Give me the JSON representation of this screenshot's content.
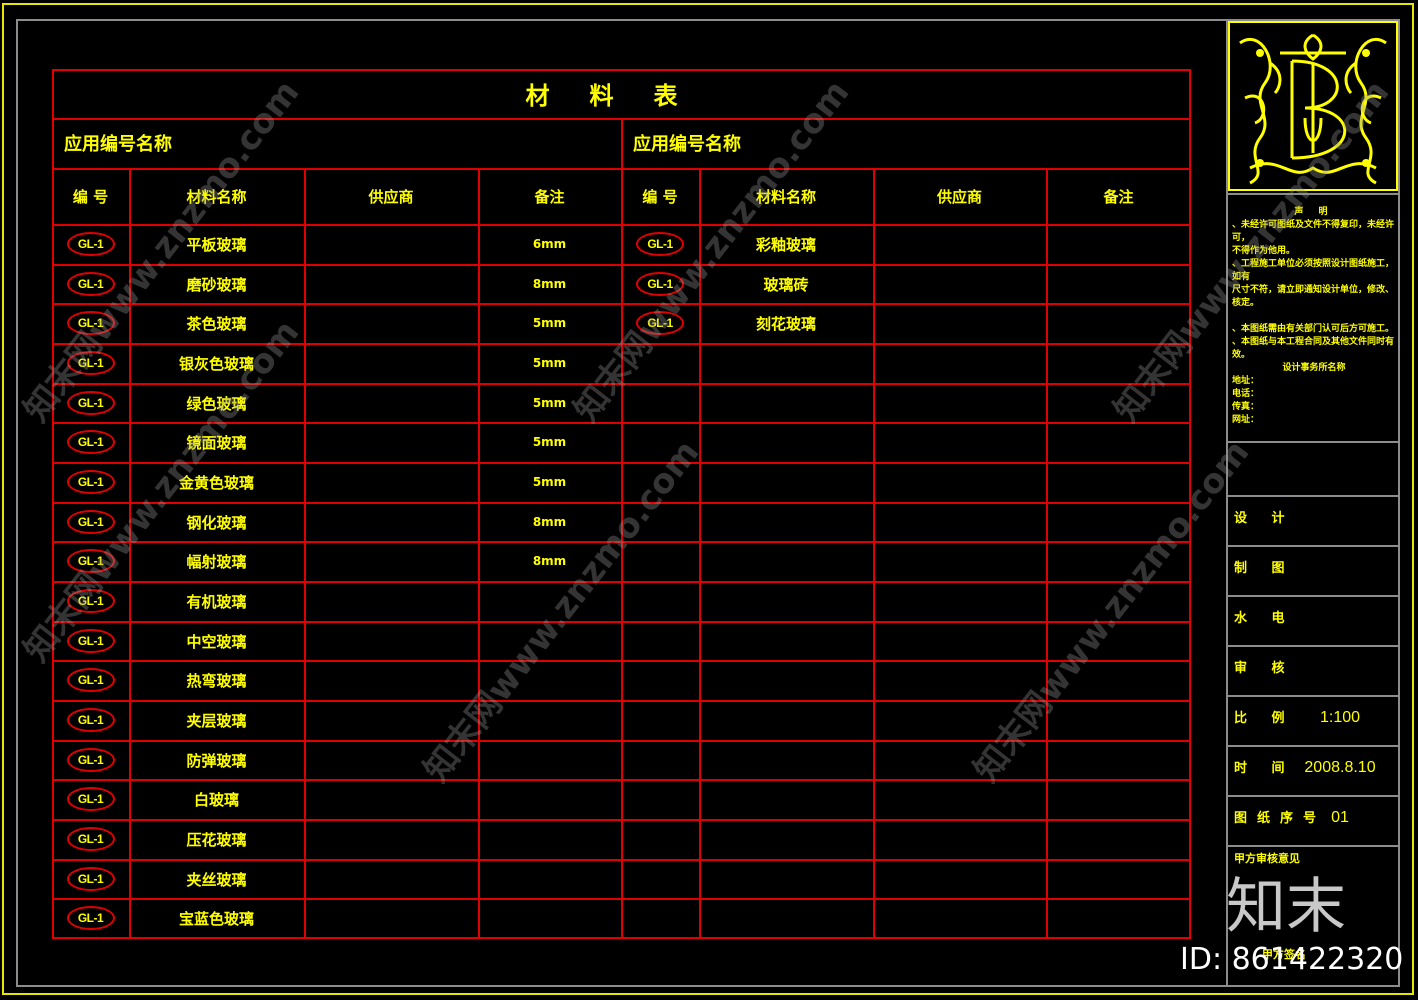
{
  "drawing": {
    "title": "材料表",
    "section_left": "应用编号名称",
    "section_right": "应用编号名称",
    "headers": [
      "编 号",
      "材料名称",
      "供应商",
      "备注"
    ],
    "left_rows": [
      {
        "code": "GL-1",
        "name": "平板玻璃",
        "supplier": "",
        "remark": "6mm"
      },
      {
        "code": "GL-1",
        "name": "磨砂玻璃",
        "supplier": "",
        "remark": "8mm"
      },
      {
        "code": "GL-1",
        "name": "茶色玻璃",
        "supplier": "",
        "remark": "5mm"
      },
      {
        "code": "GL-1",
        "name": "银灰色玻璃",
        "supplier": "",
        "remark": "5mm"
      },
      {
        "code": "GL-1",
        "name": "绿色玻璃",
        "supplier": "",
        "remark": "5mm"
      },
      {
        "code": "GL-1",
        "name": "镜面玻璃",
        "supplier": "",
        "remark": "5mm"
      },
      {
        "code": "GL-1",
        "name": "金黄色玻璃",
        "supplier": "",
        "remark": "5mm"
      },
      {
        "code": "GL-1",
        "name": "钢化玻璃",
        "supplier": "",
        "remark": "8mm"
      },
      {
        "code": "GL-1",
        "name": "幅射玻璃",
        "supplier": "",
        "remark": "8mm"
      },
      {
        "code": "GL-1",
        "name": "有机玻璃",
        "supplier": "",
        "remark": ""
      },
      {
        "code": "GL-1",
        "name": "中空玻璃",
        "supplier": "",
        "remark": ""
      },
      {
        "code": "GL-1",
        "name": "热弯玻璃",
        "supplier": "",
        "remark": ""
      },
      {
        "code": "GL-1",
        "name": "夹层玻璃",
        "supplier": "",
        "remark": ""
      },
      {
        "code": "GL-1",
        "name": "防弹玻璃",
        "supplier": "",
        "remark": ""
      },
      {
        "code": "GL-1",
        "name": "白玻璃",
        "supplier": "",
        "remark": ""
      },
      {
        "code": "GL-1",
        "name": "压花玻璃",
        "supplier": "",
        "remark": ""
      },
      {
        "code": "GL-1",
        "name": "夹丝玻璃",
        "supplier": "",
        "remark": ""
      },
      {
        "code": "GL-1",
        "name": "宝蓝色玻璃",
        "supplier": "",
        "remark": ""
      }
    ],
    "right_rows": [
      {
        "code": "GL-1",
        "name": "彩釉玻璃",
        "supplier": "",
        "remark": ""
      },
      {
        "code": "GL-1",
        "name": "玻璃砖",
        "supplier": "",
        "remark": ""
      },
      {
        "code": "GL-1",
        "name": "刻花玻璃",
        "supplier": "",
        "remark": ""
      }
    ],
    "total_rows": 18
  },
  "title_block": {
    "logo": "ornamental-monogram-B",
    "statement_title": "声  明",
    "statement_lines": [
      "、未经许可图纸及文件不得复印，未经许可，",
      "不得作为他用。",
      "、工程施工单位必须按照设计图纸施工，如有",
      "尺寸不符，请立即通知设计单位，修改、核定。",
      "",
      "、本图纸需由有关部门认可后方可施工。",
      "、本图纸与本工程合同及其他文件同时有效。",
      "设计事务所名称",
      "地址：",
      "电话：",
      "传真：",
      "网址："
    ],
    "fields": [
      {
        "label": "设  计",
        "value": ""
      },
      {
        "label": "制  图",
        "value": ""
      },
      {
        "label": "水  电",
        "value": ""
      },
      {
        "label": "审  核",
        "value": ""
      },
      {
        "label": "比  例",
        "value": "1:100"
      },
      {
        "label": "时  间",
        "value": "2008.8.10"
      },
      {
        "label": "图纸序号",
        "value": "01"
      }
    ],
    "client_opinion_label": "甲方审核意见",
    "signature_label": "甲方签名"
  },
  "watermarks": {
    "site": "知末网www.znzmo.com",
    "brand": "知末",
    "id_text": "ID: 861422320"
  },
  "colors": {
    "background": "#000000",
    "table_lines": "#e00000",
    "text": "#ffff00",
    "frame_outer": "#e6e600",
    "frame_inner": "#8c8c8c"
  }
}
